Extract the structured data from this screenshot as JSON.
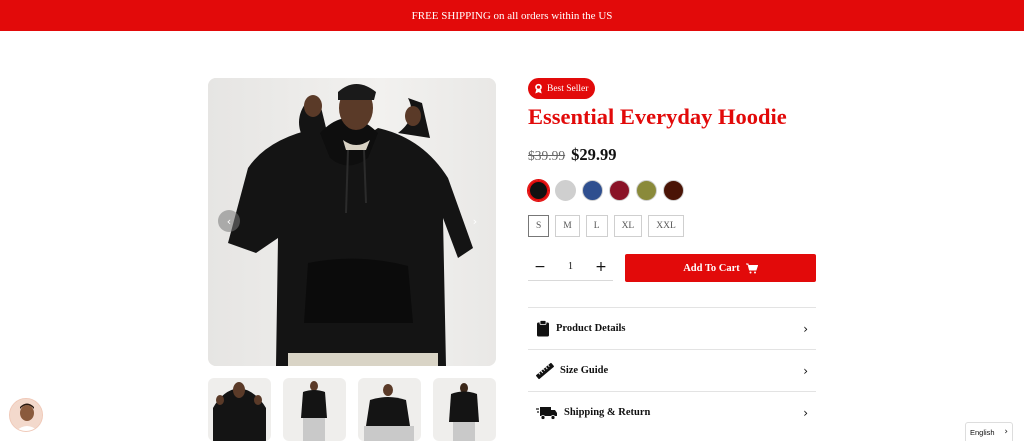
{
  "announcement": {
    "text": "FREE SHIPPING on all orders within the US"
  },
  "gallery": {
    "prev_icon": "chevron-left-icon",
    "next_icon": "chevron-right-icon",
    "thumbnails": [
      "hoodie-front-thumb",
      "hoodie-full-front-thumb",
      "hoodie-seated-thumb",
      "hoodie-back-thumb"
    ]
  },
  "product": {
    "badge": "Best Seller",
    "badge_icon": "award-icon",
    "title": "Essential Everyday Hoodie",
    "old_price": "$39.99",
    "price": "$29.99",
    "colors": [
      "#111111",
      "#cfcfcf",
      "#2f4f8f",
      "#8a1327",
      "#8a8a3a",
      "#4a1406"
    ],
    "sizes": [
      "S",
      "M",
      "L",
      "XL",
      "XXL"
    ],
    "selected_size": "S",
    "quantity": "1",
    "add_to_cart": "Add To Cart",
    "accent": "#e20a0a"
  },
  "accordion": [
    {
      "label": "Product Details",
      "icon": "clipboard-icon"
    },
    {
      "label": "Size Guide",
      "icon": "ruler-icon"
    },
    {
      "label": "Shipping & Return",
      "icon": "truck-icon"
    }
  ],
  "language": {
    "label": "English"
  }
}
